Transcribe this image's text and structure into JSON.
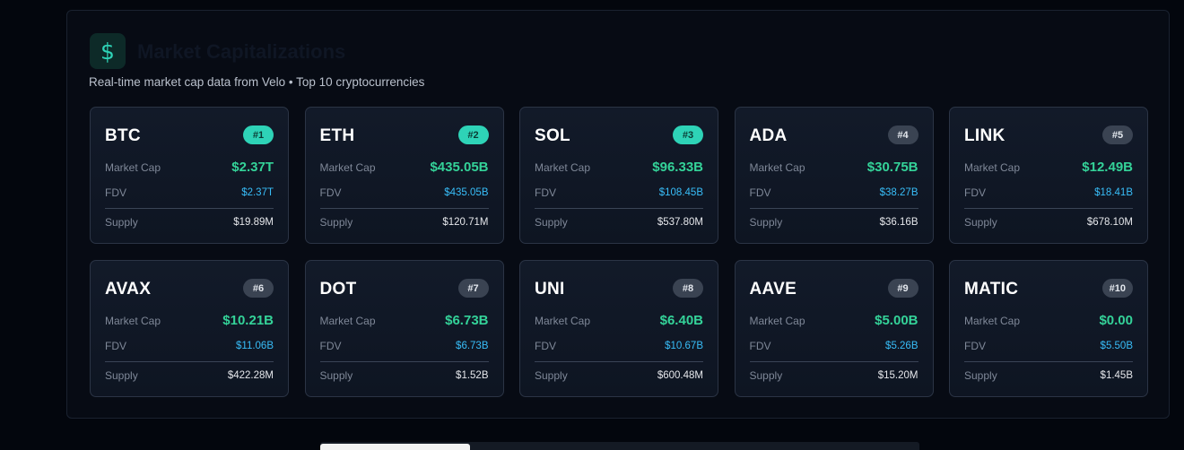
{
  "header": {
    "icon": "dollar-icon",
    "title": "Market Capitalizations",
    "subtitle": "Real-time market cap data from Velo • Top 10 cryptocurrencies"
  },
  "labels": {
    "market_cap": "Market Cap",
    "fdv": "FDV",
    "supply": "Supply"
  },
  "colors": {
    "accent_teal": "#2ed3b7",
    "market_cap_green": "#34d399",
    "fdv_blue": "#38bdf8"
  },
  "cards": [
    {
      "symbol": "BTC",
      "rank": "#1",
      "market_cap": "$2.37T",
      "fdv": "$2.37T",
      "supply": "$19.89M"
    },
    {
      "symbol": "ETH",
      "rank": "#2",
      "market_cap": "$435.05B",
      "fdv": "$435.05B",
      "supply": "$120.71M"
    },
    {
      "symbol": "SOL",
      "rank": "#3",
      "market_cap": "$96.33B",
      "fdv": "$108.45B",
      "supply": "$537.80M"
    },
    {
      "symbol": "ADA",
      "rank": "#4",
      "market_cap": "$30.75B",
      "fdv": "$38.27B",
      "supply": "$36.16B"
    },
    {
      "symbol": "LINK",
      "rank": "#5",
      "market_cap": "$12.49B",
      "fdv": "$18.41B",
      "supply": "$678.10M"
    },
    {
      "symbol": "AVAX",
      "rank": "#6",
      "market_cap": "$10.21B",
      "fdv": "$11.06B",
      "supply": "$422.28M"
    },
    {
      "symbol": "DOT",
      "rank": "#7",
      "market_cap": "$6.73B",
      "fdv": "$6.73B",
      "supply": "$1.52B"
    },
    {
      "symbol": "UNI",
      "rank": "#8",
      "market_cap": "$6.40B",
      "fdv": "$10.67B",
      "supply": "$600.48M"
    },
    {
      "symbol": "AAVE",
      "rank": "#9",
      "market_cap": "$5.00B",
      "fdv": "$5.26B",
      "supply": "$15.20M"
    },
    {
      "symbol": "MATIC",
      "rank": "#10",
      "market_cap": "$0.00",
      "fdv": "$5.50B",
      "supply": "$1.45B"
    }
  ]
}
